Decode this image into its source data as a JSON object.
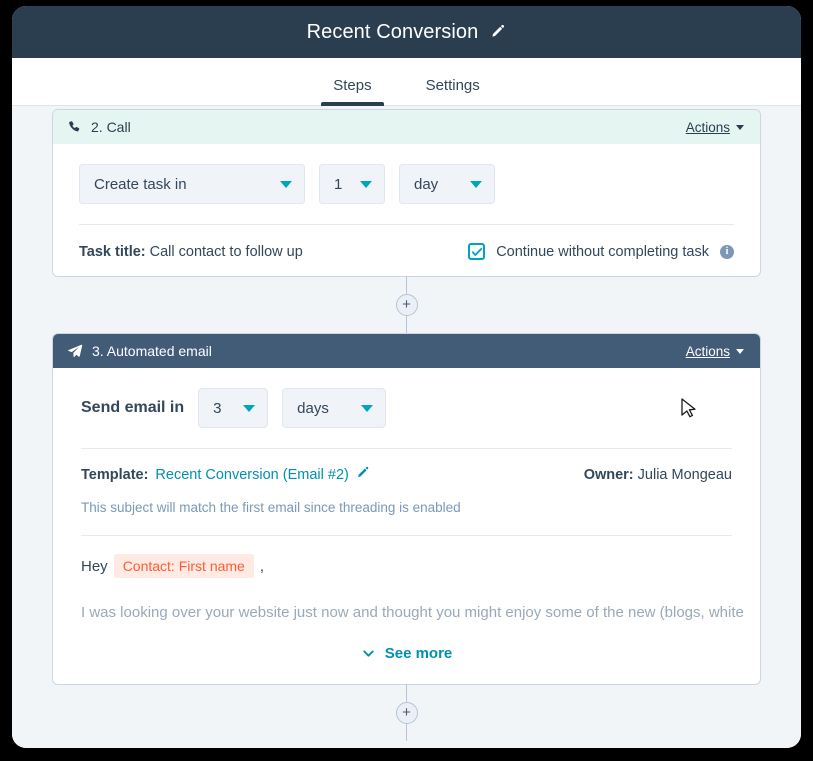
{
  "window": {
    "title": "Recent Conversion",
    "edit_icon": "pencil-icon"
  },
  "tabs": [
    {
      "label": "Steps",
      "active": true
    },
    {
      "label": "Settings",
      "active": false
    }
  ],
  "steps": [
    {
      "id": "call",
      "icon": "phone-icon",
      "title": "2. Call",
      "actions_label": "Actions",
      "selects": [
        {
          "name": "action-type",
          "value": "Create task in"
        },
        {
          "name": "delay-amount",
          "value": "1"
        },
        {
          "name": "delay-unit",
          "value": "day"
        }
      ],
      "task_title_label": "Task title:",
      "task_title_value": "Call contact to follow up",
      "checkbox": {
        "label": "Continue without completing task",
        "checked": true,
        "info_icon": "info-icon"
      }
    },
    {
      "id": "automated-email",
      "icon": "paper-plane-icon",
      "title": "3. Automated email",
      "actions_label": "Actions",
      "send_label": "Send email in",
      "selects": [
        {
          "name": "delay-amount",
          "value": "3"
        },
        {
          "name": "delay-unit",
          "value": "days"
        }
      ],
      "template_label": "Template:",
      "template_name": "Recent Conversion (Email #2)",
      "template_edit_icon": "pencil-icon",
      "owner_label": "Owner:",
      "owner_name": "Julia Mongeau",
      "subject_note": "This subject will match the first email since threading is enabled",
      "email_greeting": "Hey",
      "email_token": "Contact: First name",
      "email_greeting_suffix": ",",
      "email_body_line": "I was looking over your website just now and thought you might enjoy some of the new (blogs, white",
      "see_more_label": "See more"
    }
  ],
  "connectors": {
    "add_step_label": "+"
  },
  "colors": {
    "titlebar_bg": "#2a3e50",
    "call_header_bg": "#e5f5f1",
    "email_header_bg": "#425b76",
    "accent_teal": "#00a4bd",
    "link_blue": "#0091ae",
    "token_orange": "#ff5c35",
    "token_bg": "#ffeae4",
    "canvas_bg": "#f1f5f8"
  }
}
